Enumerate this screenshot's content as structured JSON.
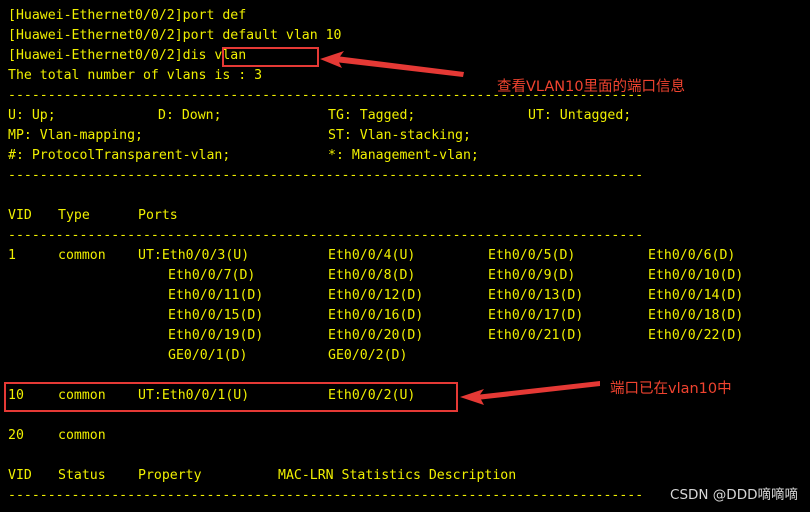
{
  "terminal": {
    "cmd1": "[Huawei-Ethernet0/0/2]port def",
    "cmd2": "[Huawei-Ethernet0/0/2]port default vlan 10",
    "cmd3_prompt": "[Huawei-Ethernet0/0/2]",
    "cmd3_command": "dis vlan",
    "total": "The total number of vlans is : 3",
    "dashes": "--------------------------------------------------------------------------------",
    "legend1": [
      "U: Up;",
      "D: Down;",
      "TG: Tagged;",
      "UT: Untagged;"
    ],
    "legend2": [
      "MP: Vlan-mapping;",
      "ST: Vlan-stacking;"
    ],
    "legend3": [
      "#: ProtocolTransparent-vlan;",
      "*: Management-vlan;"
    ],
    "header": {
      "vid": "VID",
      "type": "Type",
      "ports": "Ports"
    },
    "vlan1": {
      "vid": "1",
      "type": "common",
      "rows": [
        [
          "UT:Eth0/0/3(U)",
          "Eth0/0/4(U)",
          "Eth0/0/5(D)",
          "Eth0/0/6(D)"
        ],
        [
          "Eth0/0/7(D)",
          "Eth0/0/8(D)",
          "Eth0/0/9(D)",
          "Eth0/0/10(D)"
        ],
        [
          "Eth0/0/11(D)",
          "Eth0/0/12(D)",
          "Eth0/0/13(D)",
          "Eth0/0/14(D)"
        ],
        [
          "Eth0/0/15(D)",
          "Eth0/0/16(D)",
          "Eth0/0/17(D)",
          "Eth0/0/18(D)"
        ],
        [
          "Eth0/0/19(D)",
          "Eth0/0/20(D)",
          "Eth0/0/21(D)",
          "Eth0/0/22(D)"
        ],
        [
          "GE0/0/1(D)",
          "GE0/0/2(D)",
          "",
          ""
        ]
      ]
    },
    "vlan10": {
      "vid": "10",
      "type": "common",
      "ports": [
        "UT:Eth0/0/1(U)",
        "Eth0/0/2(U)"
      ]
    },
    "vlan20": {
      "vid": "20",
      "type": "common"
    },
    "header2": {
      "vid": "VID",
      "status": "Status",
      "property": "Property",
      "rest": "MAC-LRN Statistics Description"
    }
  },
  "annotations": {
    "top": "查看VLAN10里面的端口信息",
    "mid": "端口已在vlan10中"
  },
  "watermark": "CSDN @DDD嘀嘀嘀",
  "colors": {
    "background": "#000000",
    "terminal_text": "#f0f000",
    "highlight": "#e53935",
    "annotation_text": "#f0432f",
    "watermark": "#d7d7d7"
  }
}
